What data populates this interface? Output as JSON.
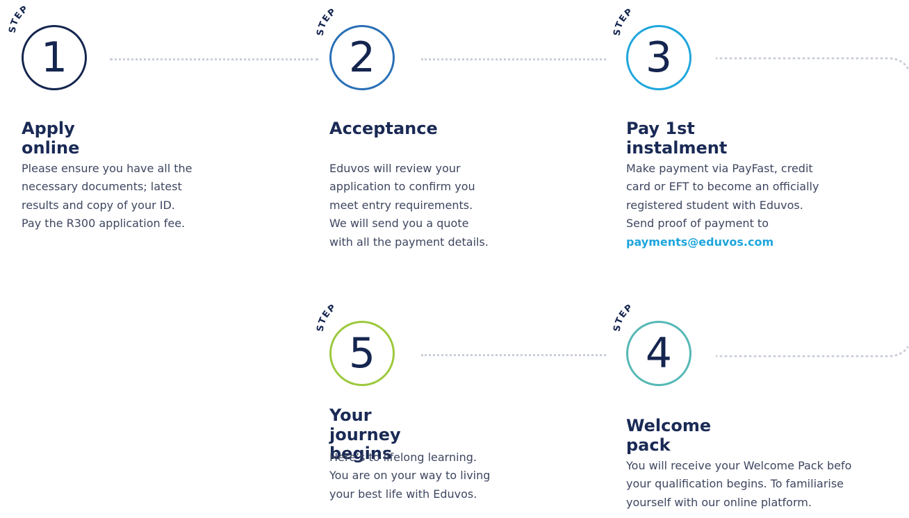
{
  "step_word": "STEP",
  "colors": {
    "navy": "#14254f",
    "blue": "#2a6fb6",
    "cyan": "#1ea6dc",
    "teal": "#55b8b5",
    "green": "#9cc93c",
    "dots": "#c9ced8"
  },
  "steps": {
    "s1": {
      "number": "1",
      "title": "Apply online",
      "lines": [
        "Please ensure you have all the",
        "necessary documents; latest",
        "results and copy of your ID.",
        "Pay the R300 application fee."
      ]
    },
    "s2": {
      "number": "2",
      "title": "Acceptance",
      "lines": [
        "Eduvos will review your",
        "application to confirm you",
        "meet entry requirements.",
        "We will send you a quote",
        "with all the payment details."
      ]
    },
    "s3": {
      "number": "3",
      "title": "Pay 1st instalment",
      "lines": [
        "Make payment via PayFast, credit",
        "card or EFT to become an officially",
        "registered student with Eduvos.",
        "Send proof of payment to"
      ],
      "link": "payments@eduvos.com"
    },
    "s4": {
      "number": "4",
      "title": "Welcome pack",
      "lines": [
        "You will receive your Welcome Pack befo",
        "your qualification begins. To familiarise",
        "yourself with our online platform."
      ]
    },
    "s5": {
      "number": "5",
      "title_line1": "Your journey",
      "title_line2": "begins",
      "lines": [
        "Here’s to lifelong learning.",
        "You are on your way to living",
        "your best life with Eduvos."
      ]
    }
  }
}
